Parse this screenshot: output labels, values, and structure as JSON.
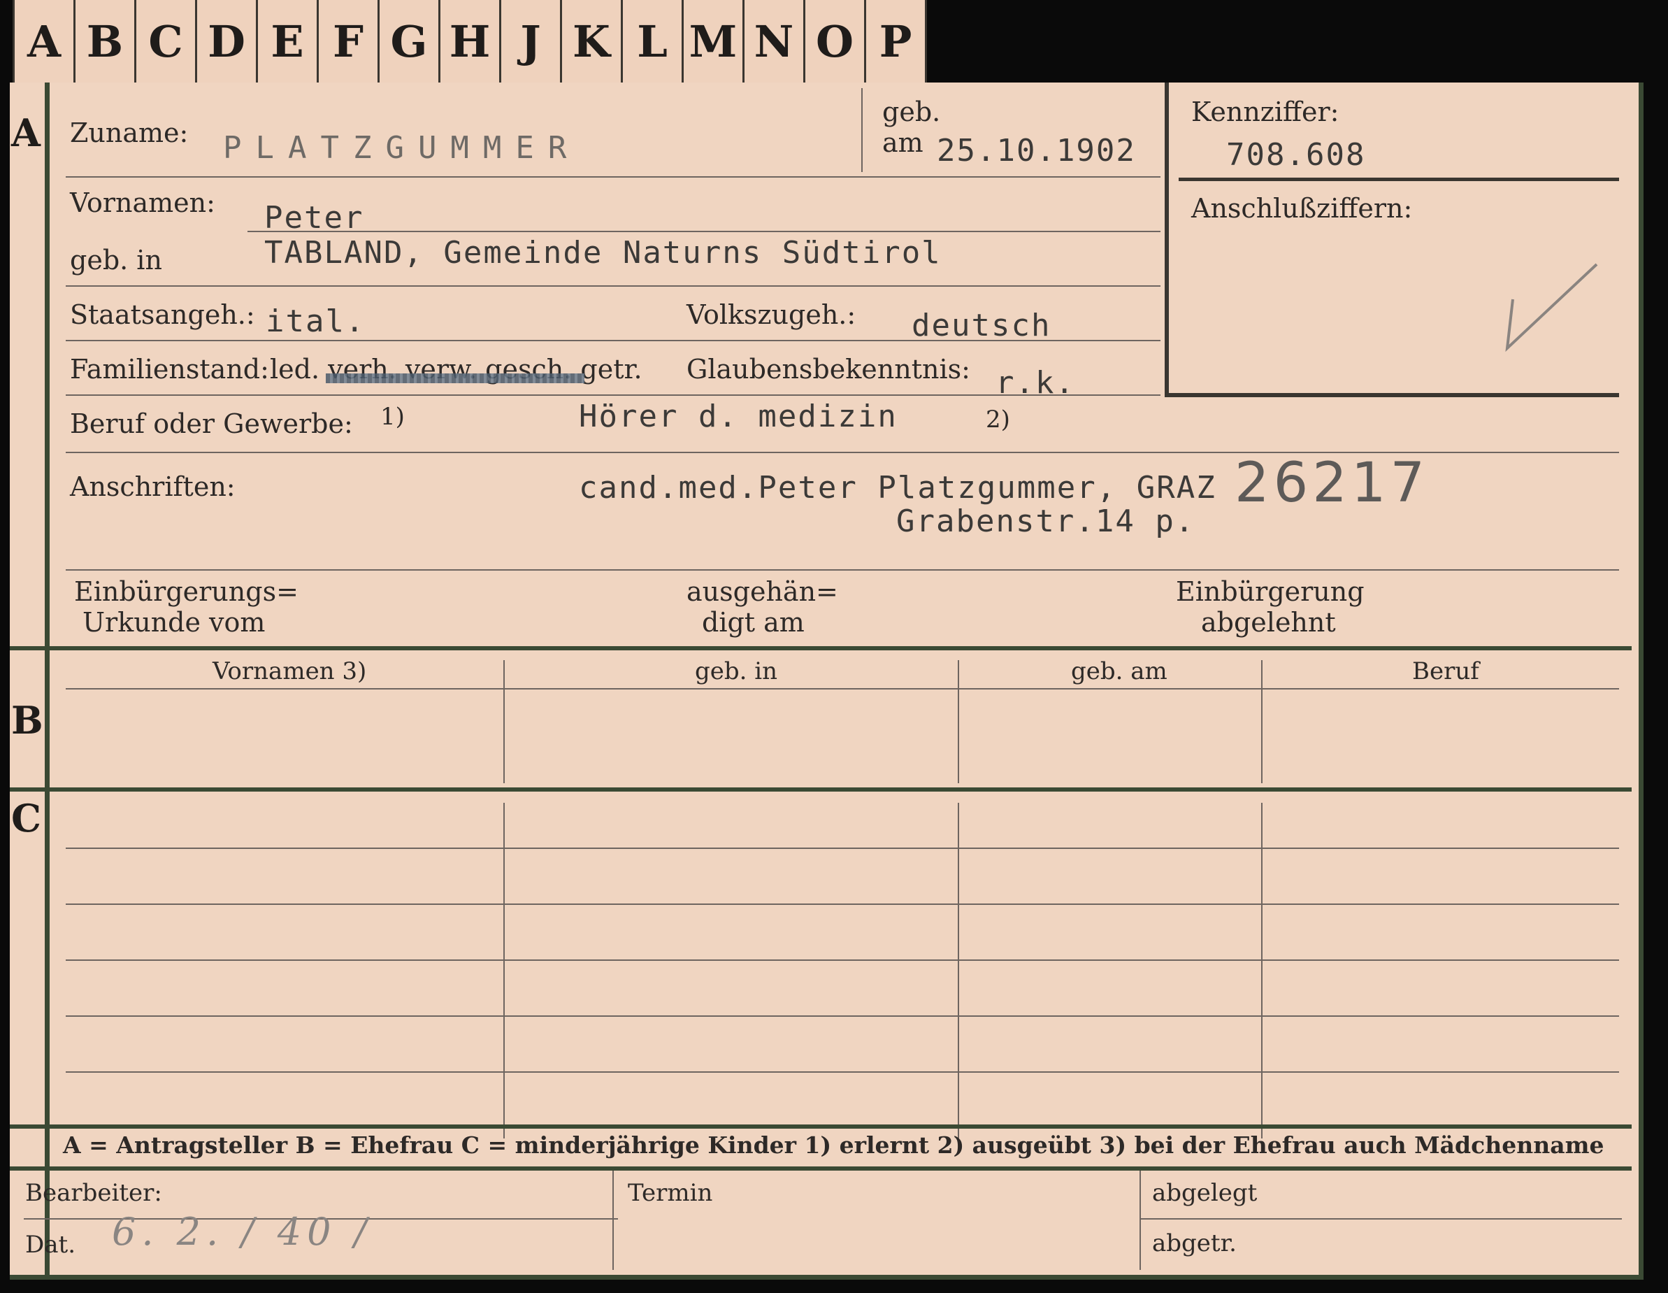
{
  "tabs": [
    "A",
    "B",
    "C",
    "D",
    "E",
    "F",
    "G",
    "H",
    "J",
    "K",
    "L",
    "M",
    "N",
    "O",
    "P"
  ],
  "sections": {
    "a": "A",
    "b": "B",
    "c": "C"
  },
  "labels": {
    "zuname": "Zuname:",
    "geb_am_1": "geb.",
    "geb_am_2": "am",
    "kennziffer": "Kennziffer:",
    "anschlussziffern": "Anschlußziffern:",
    "vornamen": "Vornamen:",
    "geb_in": "geb. in",
    "staatsangeh": "Staatsangeh.:",
    "volkszugeh": "Volkszugeh.:",
    "familienstand": "Familienstand:",
    "familienstand_options": "led. verh. verw. gesch. getr.",
    "glaubensbekenntnis": "Glaubensbekenntnis:",
    "beruf": "Beruf oder Gewerbe:",
    "note1": "1)",
    "note2": "2)",
    "anschriften": "Anschriften:",
    "einbuergerungsurkunde_1": "Einbürgerungs=",
    "einbuergerungsurkunde_2": "Urkunde vom",
    "ausgehaendigt_1": "ausgehän=",
    "ausgehaendigt_2": "digt am",
    "einbuergerung_abgelehnt_1": "Einbürgerung",
    "einbuergerung_abgelehnt_2": "abgelehnt"
  },
  "values": {
    "zuname": "PLATZGUMMER",
    "geb_am": "25.10.1902",
    "kennziffer": "708.608",
    "vornamen": "Peter",
    "geb_in": "TABLAND, Gemeinde Naturns Südtirol",
    "staatsangeh": "ital.",
    "volkszugeh": "deutsch",
    "glaubensbekenntnis": "r.k.",
    "beruf": "Hörer d. medizin",
    "anschrift_1": "cand.med.Peter Platzgummer, GRAZ",
    "anschrift_2": "Grabenstr.14 p.",
    "stamp_number": "26217"
  },
  "table_headers": {
    "vornamen": "Vornamen 3)",
    "geb_in": "geb. in",
    "geb_am": "geb. am",
    "beruf": "Beruf"
  },
  "legend": "A = Antragsteller   B = Ehefrau   C = minderjährige Kinder   1) erlernt   2) ausgeübt   3) bei der Ehefrau auch Mädchenname",
  "footer": {
    "bearbeiter": "Bearbeiter:",
    "dat": "Dat.",
    "dat_value": "6. 2. / 40 /",
    "termin": "Termin",
    "abgelegt": "abgelegt",
    "abgetr": "abgetr."
  },
  "colors": {
    "card": "#f0d5c1",
    "frame": "#3b4a34",
    "ink": "#3c3a38"
  }
}
